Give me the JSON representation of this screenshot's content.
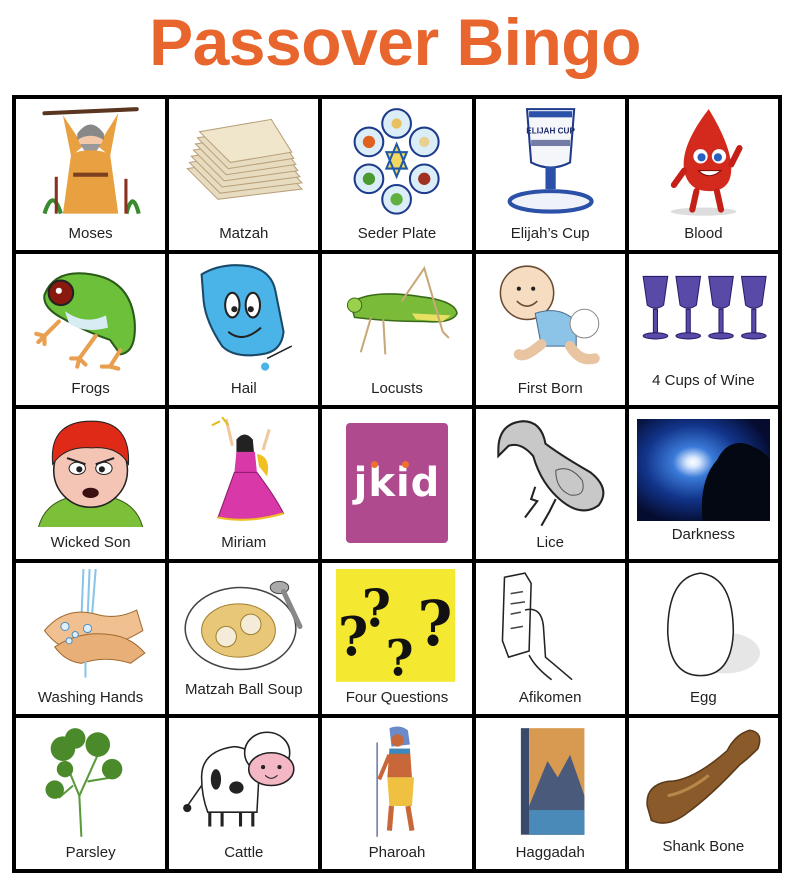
{
  "title": "Passover Bingo",
  "colors": {
    "title": "#e8652e",
    "grid": "#000000",
    "free_space": "#b04a8e",
    "free_space_dot": "#f07030"
  },
  "free_space_text": "jkid",
  "cells": [
    {
      "label": "Moses",
      "icon": "moses"
    },
    {
      "label": "Matzah",
      "icon": "matzah"
    },
    {
      "label": "Seder Plate",
      "icon": "seder-plate"
    },
    {
      "label": "Elijah’s Cup",
      "icon": "elijahs-cup",
      "cup_text": "ELIJAH CUP"
    },
    {
      "label": "Blood",
      "icon": "blood-drop"
    },
    {
      "label": "Frogs",
      "icon": "frog"
    },
    {
      "label": "Hail",
      "icon": "hail"
    },
    {
      "label": "Locusts",
      "icon": "locust"
    },
    {
      "label": "First Born",
      "icon": "baby"
    },
    {
      "label": "4 Cups of Wine",
      "icon": "wine-glasses"
    },
    {
      "label": "Wicked Son",
      "icon": "angry-boy"
    },
    {
      "label": "Miriam",
      "icon": "dancing-woman"
    },
    {
      "label": "",
      "icon": "jkid-logo",
      "free_space": true
    },
    {
      "label": "Lice",
      "icon": "louse"
    },
    {
      "label": "Darkness",
      "icon": "night-sky"
    },
    {
      "label": "Washing Hands",
      "icon": "washing-hands"
    },
    {
      "label": "Matzah Ball Soup",
      "icon": "soup-bowl"
    },
    {
      "label": "Four Questions",
      "icon": "question-marks"
    },
    {
      "label": "Afikomen",
      "icon": "hand-holding-matzah"
    },
    {
      "label": "Egg",
      "icon": "egg"
    },
    {
      "label": "Parsley",
      "icon": "parsley"
    },
    {
      "label": "Cattle",
      "icon": "cow"
    },
    {
      "label": "Pharoah",
      "icon": "pharaoh"
    },
    {
      "label": "Haggadah",
      "icon": "book"
    },
    {
      "label": "Shank Bone",
      "icon": "bone"
    }
  ]
}
